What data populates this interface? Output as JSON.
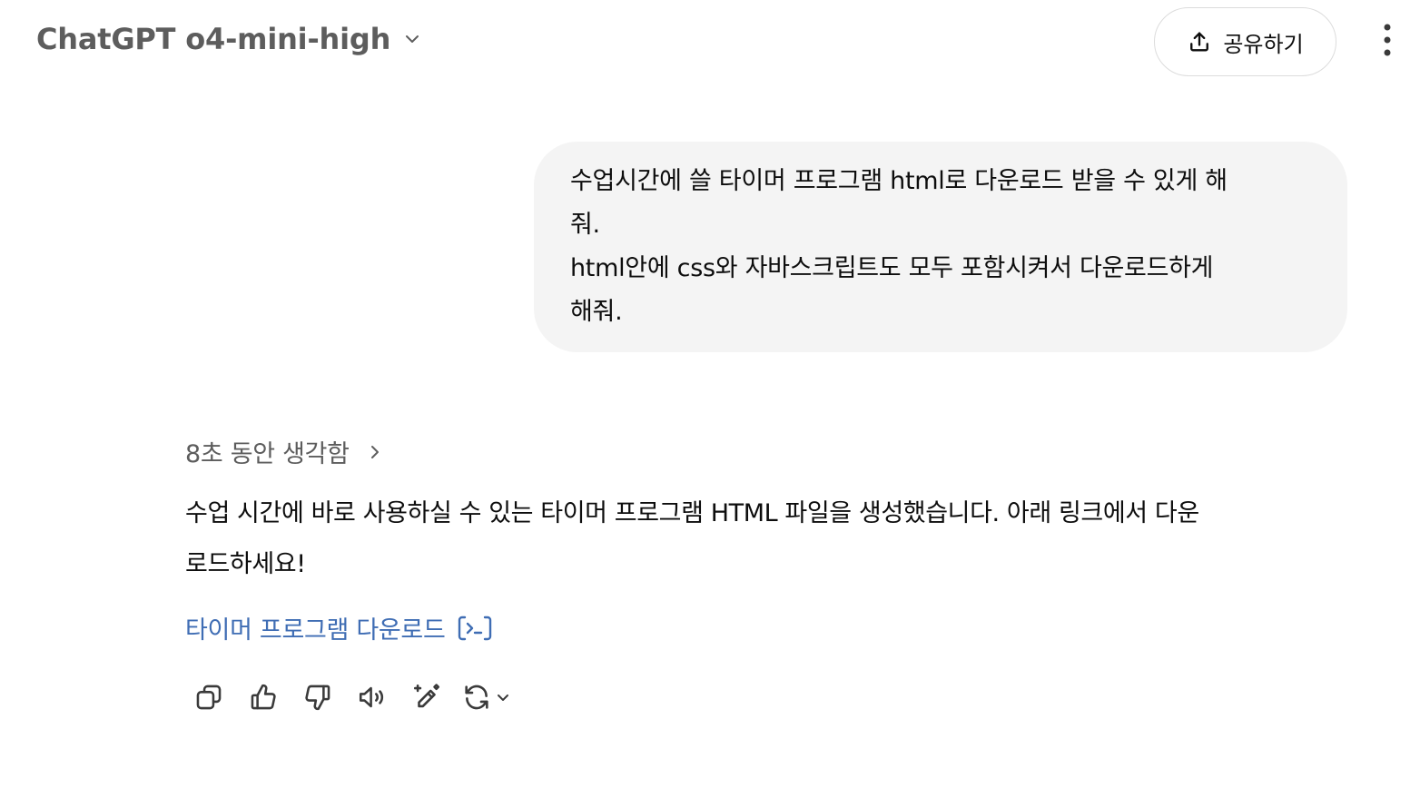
{
  "header": {
    "model_name": "ChatGPT o4-mini-high",
    "share_label": "공유하기",
    "icons": {
      "model_dropdown": "chevron-down-icon",
      "share": "upload-icon",
      "more": "more-vertical-icon"
    }
  },
  "conversation": {
    "user_message": {
      "lines": [
        "수업시간에 쓸 타이머 프로그램 html로 다운로드 받을 수 있게 해",
        "줘.",
        "html안에 css와 자바스크립트도 모두 포함시켜서 다운로드하게",
        "해줘."
      ]
    },
    "assistant_message": {
      "thought_label": "8초 동안 생각함",
      "lines": [
        "수업 시간에 바로 사용하실 수 있는 타이머 프로그램 HTML 파일을 생성했습니다. 아래 링크에서 다운",
        "로드하세요!"
      ],
      "download_link_label": "타이머 프로그램 다운로드"
    }
  },
  "actions": [
    {
      "name": "copy",
      "icon": "copy-icon"
    },
    {
      "name": "thumbs-up",
      "icon": "thumbs-up-icon"
    },
    {
      "name": "thumbs-down",
      "icon": "thumbs-down-icon"
    },
    {
      "name": "read-aloud",
      "icon": "speaker-icon"
    },
    {
      "name": "edit",
      "icon": "edit-sparkle-icon"
    },
    {
      "name": "regenerate",
      "icon": "refresh-icon"
    }
  ],
  "colors": {
    "link": "#3f6db4",
    "bubble_bg": "#f4f4f4",
    "muted_text": "#5d5d5d"
  }
}
